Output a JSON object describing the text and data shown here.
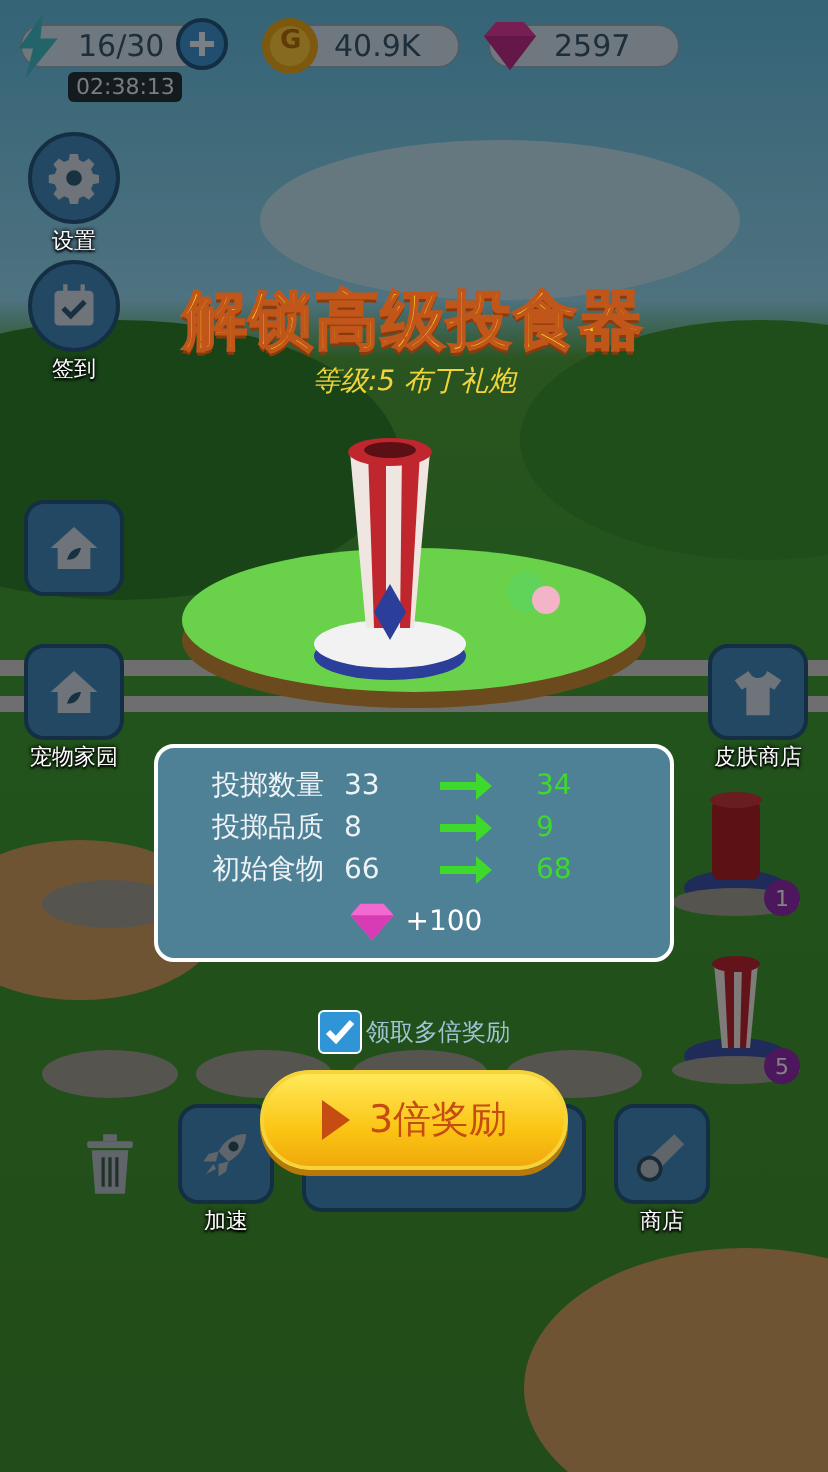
{
  "hud": {
    "energy": "16/30",
    "timer": "02:38:13",
    "coins": "40.9K",
    "coin_symbol": "G",
    "gems": "2597"
  },
  "side_buttons": [
    {
      "kind": "settings",
      "label": "设置"
    },
    {
      "kind": "checkin",
      "label": "签到"
    },
    {
      "kind": "home"
    },
    {
      "kind": "home",
      "label": "宠物家园"
    },
    {
      "kind": "skin",
      "label": "皮肤商店"
    }
  ],
  "cannons": [
    {
      "kind": "red",
      "badge": "1"
    },
    {
      "kind": "striped",
      "badge": "5"
    }
  ],
  "bottom_bar": [
    {
      "kind": "trash"
    },
    {
      "kind": "rocket",
      "label": "加速"
    },
    {
      "kind": "wide"
    },
    {
      "kind": "cannon",
      "label": "商店"
    }
  ],
  "dialog": {
    "title": "解锁高级投食器",
    "subtitle": "等级:5  布丁礼炮",
    "stats": [
      {
        "label": "投掷数量",
        "current": "33",
        "next": "34"
      },
      {
        "label": "投掷品质",
        "current": "8",
        "next": "9"
      },
      {
        "label": "初始食物",
        "current": "66",
        "next": "68"
      }
    ],
    "reward": "+100",
    "multi_reward": {
      "label": "领取多倍奖励",
      "checked": true
    },
    "button": "3倍奖励"
  }
}
